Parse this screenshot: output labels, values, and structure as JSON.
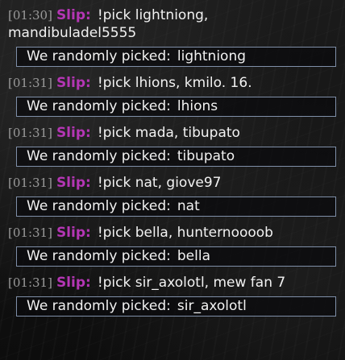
{
  "colors": {
    "username": "#b436b4",
    "timestamp": "#9a9a9a",
    "message_text": "#f2f2f2",
    "response_border": "#7f8fa8"
  },
  "messages": [
    {
      "timestamp": "[01:30]",
      "user": "Slip:",
      "command": "!pick lightniong, mandibuladel5555",
      "response_prefix": "We randomly picked:",
      "response_value": "lightniong"
    },
    {
      "timestamp": "[01:31]",
      "user": "Slip:",
      "command": "!pick lhions, kmilo. 16.",
      "response_prefix": "We randomly picked:",
      "response_value": "lhions"
    },
    {
      "timestamp": "[01:31]",
      "user": "Slip:",
      "command": "!pick mada, tibupato",
      "response_prefix": "We randomly picked:",
      "response_value": "tibupato"
    },
    {
      "timestamp": "[01:31]",
      "user": "Slip:",
      "command": "!pick nat, giove97",
      "response_prefix": "We randomly picked:",
      "response_value": "nat"
    },
    {
      "timestamp": "[01:31]",
      "user": "Slip:",
      "command": "!pick bella, hunternoooob",
      "response_prefix": "We randomly picked:",
      "response_value": "bella"
    },
    {
      "timestamp": "[01:31]",
      "user": "Slip:",
      "command": "!pick sir_axolotl, mew fan 7",
      "response_prefix": "We randomly picked:",
      "response_value": "sir_axolotl"
    }
  ]
}
